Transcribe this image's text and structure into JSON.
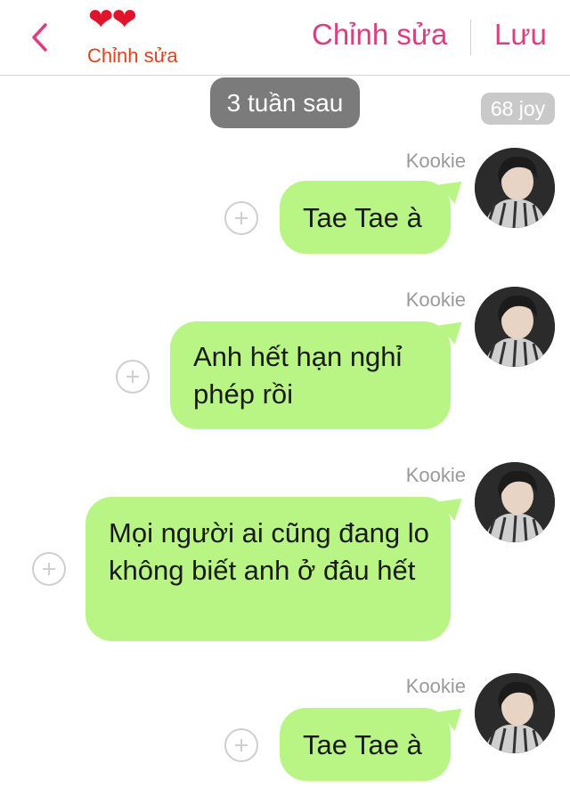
{
  "header": {
    "back_icon": "chevron-left-icon",
    "hearts": "❤❤",
    "subtitle": "Chỉnh sửa",
    "edit_label": "Chỉnh sửa",
    "save_label": "Lưu",
    "accent_color": "#db3f7f"
  },
  "time_separator": "3 tuần sau",
  "count_badge": "68 joy",
  "messages": [
    {
      "sender": "Kookie",
      "text": "Tae Tae à"
    },
    {
      "sender": "Kookie",
      "text": "Anh hết hạn nghỉ phép rồi"
    },
    {
      "sender": "Kookie",
      "text": "Mọi người ai cũng đang lo không biết anh ở đâu hết"
    },
    {
      "sender": "Kookie",
      "text": "Tae Tae à"
    }
  ],
  "colors": {
    "bubble": "#b9f584",
    "time_pill": "#7b7b7b",
    "count_pill": "#c9c9c9"
  }
}
